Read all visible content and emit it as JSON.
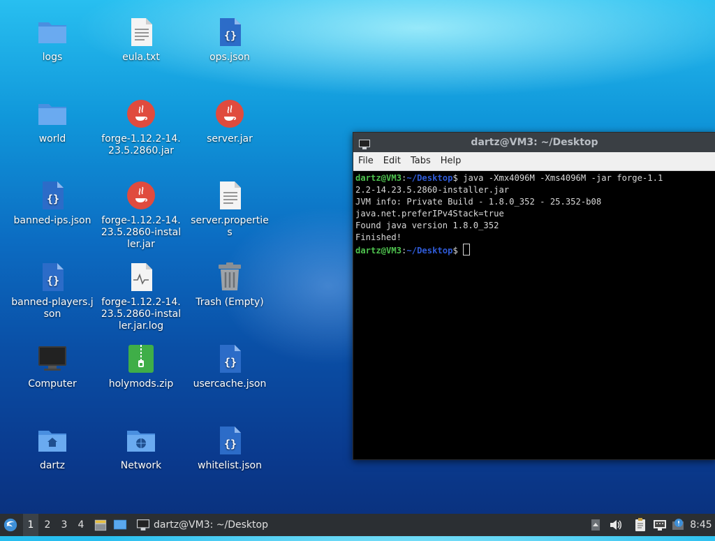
{
  "desktop": {
    "icons": [
      {
        "label": "logs",
        "icon": "folder-icon"
      },
      {
        "label": "eula.txt",
        "icon": "text-file-icon"
      },
      {
        "label": "ops.json",
        "icon": "json-file-icon"
      },
      {
        "label": "world",
        "icon": "folder-icon"
      },
      {
        "label": "forge-1.12.2-14.23.5.2860.jar",
        "icon": "java-jar-icon"
      },
      {
        "label": "server.jar",
        "icon": "java-jar-icon"
      },
      {
        "label": "banned-ips.json",
        "icon": "json-file-icon"
      },
      {
        "label": "forge-1.12.2-14.23.5.2860-installer.jar",
        "icon": "java-jar-icon"
      },
      {
        "label": "server.properties",
        "icon": "text-file-icon"
      },
      {
        "label": "banned-players.json",
        "icon": "json-file-icon"
      },
      {
        "label": "forge-1.12.2-14.23.5.2860-installer.jar.log",
        "icon": "log-file-icon"
      },
      {
        "label": "Trash (Empty)",
        "icon": "trash-icon"
      },
      {
        "label": "Computer",
        "icon": "computer-icon"
      },
      {
        "label": "holymods.zip",
        "icon": "zip-file-icon"
      },
      {
        "label": "usercache.json",
        "icon": "json-file-icon"
      },
      {
        "label": "dartz",
        "icon": "home-folder-icon"
      },
      {
        "label": "Network",
        "icon": "network-folder-icon"
      },
      {
        "label": "whitelist.json",
        "icon": "json-file-icon"
      }
    ]
  },
  "terminal": {
    "title": "dartz@VM3: ~/Desktop",
    "menu": [
      "File",
      "Edit",
      "Tabs",
      "Help"
    ],
    "prompt_user": "dartz@VM3",
    "prompt_path": "~/Desktop",
    "command": "java -Xmx4096M -Xms4096M -jar forge-1.12.2-14.23.5.2860-installer.jar",
    "output": [
      "JVM info: Private Build - 1.8.0_352 - 25.352-b08",
      "java.net.preferIPv4Stack=true",
      "Found java version 1.8.0_352",
      "Finished!"
    ]
  },
  "taskbar": {
    "workspaces": [
      "1",
      "2",
      "3",
      "4"
    ],
    "active_workspace": "1",
    "task_title": "dartz@VM3: ~/Desktop",
    "clock": "8:45"
  },
  "colors": {
    "prompt_user": "#4ec24e",
    "prompt_path": "#2f5bd8",
    "taskbar_bg": "#2b2f33"
  }
}
